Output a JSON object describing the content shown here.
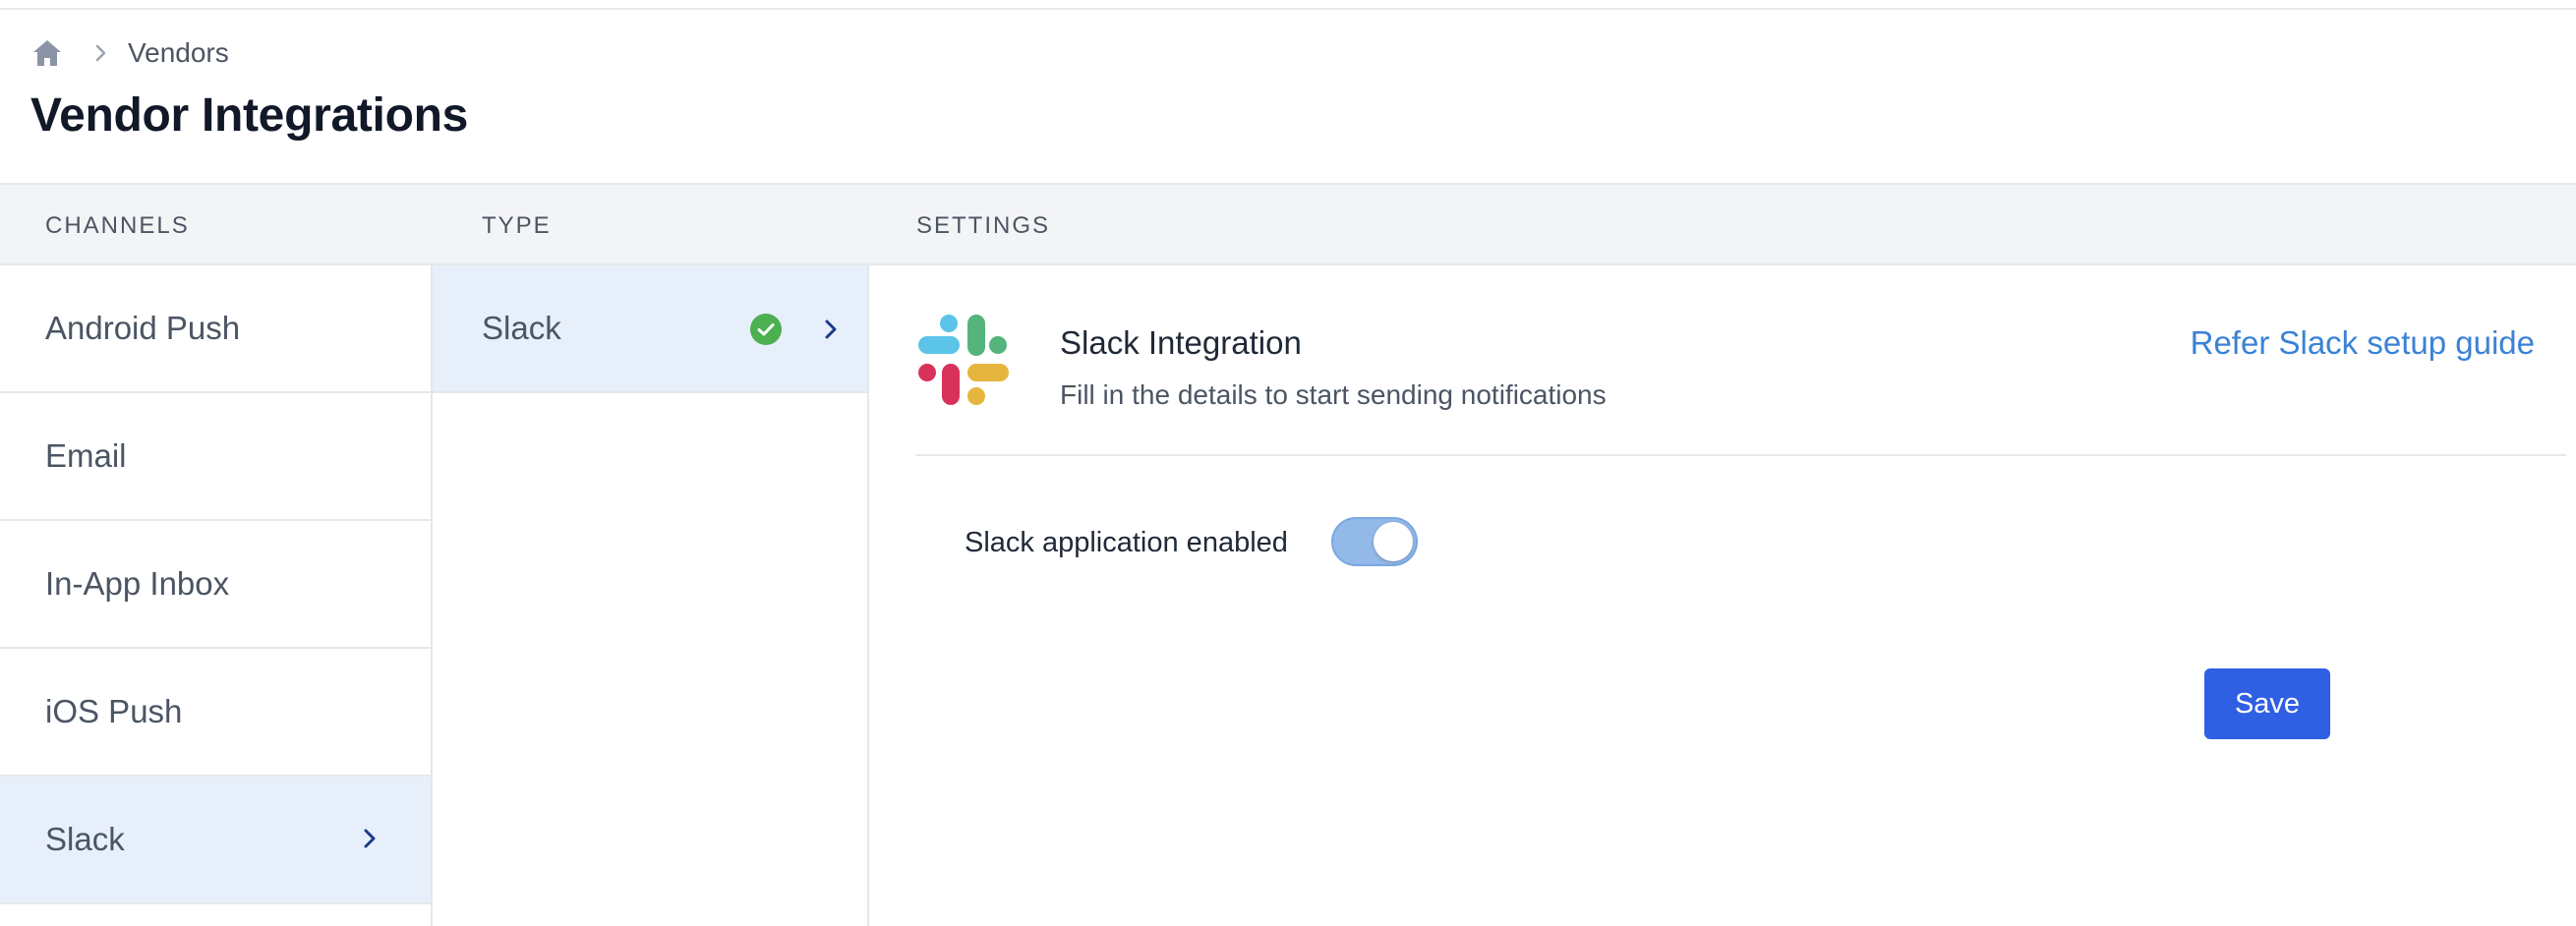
{
  "breadcrumb": {
    "home_icon": "home-icon",
    "separator_icon": "chevron-right-icon",
    "current": "Vendors"
  },
  "page_title": "Vendor Integrations",
  "columns": {
    "channels": "CHANNELS",
    "type": "TYPE",
    "settings": "SETTINGS"
  },
  "channels": [
    {
      "label": "Android Push",
      "selected": false
    },
    {
      "label": "Email",
      "selected": false
    },
    {
      "label": "In-App Inbox",
      "selected": false
    },
    {
      "label": "iOS Push",
      "selected": false
    },
    {
      "label": "Slack",
      "selected": true
    }
  ],
  "types": [
    {
      "label": "Slack",
      "status_icon": "check-circle-icon",
      "selected": true
    }
  ],
  "settings": {
    "logo_icon": "slack-logo-icon",
    "title": "Slack Integration",
    "subtitle": "Fill in the details to start sending notifications",
    "guide_link": "Refer Slack setup guide",
    "toggle_label": "Slack application enabled",
    "toggle_on": true,
    "save_label": "Save"
  },
  "colors": {
    "accent": "#2f5fe3",
    "link": "#3b82d6",
    "selected_bg": "#e7effa",
    "success": "#4caf50",
    "toggle_on": "#93b9e8"
  }
}
